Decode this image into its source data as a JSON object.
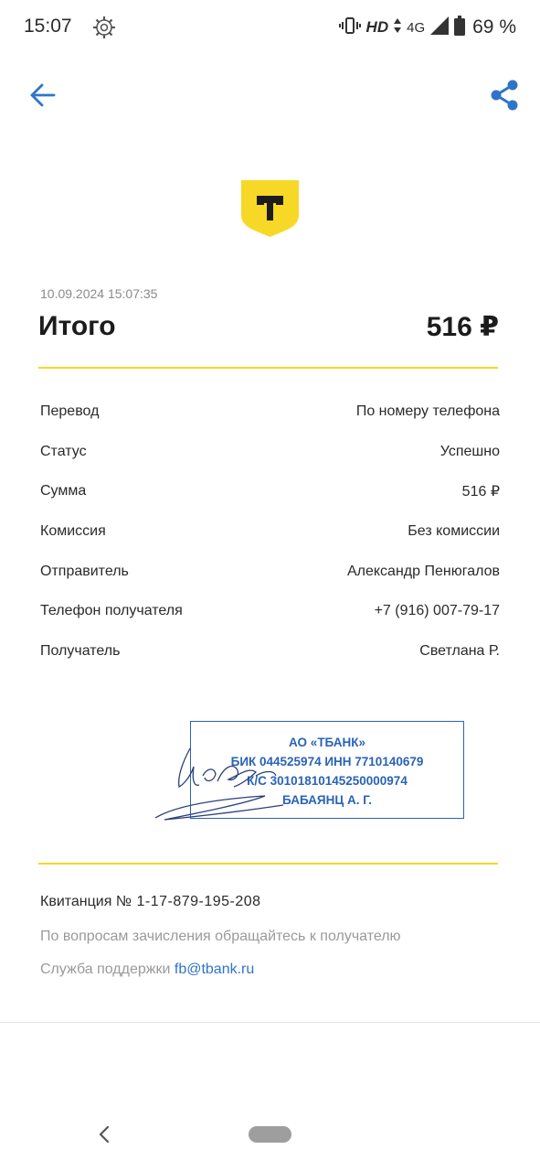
{
  "status_bar": {
    "time": "15:07",
    "hd": "HD",
    "network": "4G",
    "battery": "69 %"
  },
  "toolbar": {
    "back_icon": "arrow-left-icon",
    "share_icon": "share-icon"
  },
  "colors": {
    "accent": "#2f74c8",
    "brand_yellow": "#f7d827",
    "stamp_blue": "#2a63b6"
  },
  "logo": {
    "letter": "Т"
  },
  "receipt": {
    "datetime": "10.09.2024  15:07:35",
    "total_label": "Итого",
    "total_amount": "516 ₽",
    "rows": [
      {
        "label": "Перевод",
        "value": "По номеру телефона"
      },
      {
        "label": "Статус",
        "value": "Успешно"
      },
      {
        "label": "Сумма",
        "value": "516 ₽"
      },
      {
        "label": "Комиссия",
        "value": "Без комиссии"
      },
      {
        "label": "Отправитель",
        "value": "Александр Пенюгалов"
      },
      {
        "label": "Телефон получателя",
        "value": "+7 (916) 007-79-17"
      },
      {
        "label": "Получатель",
        "value": "Светлана Р."
      }
    ]
  },
  "stamp": {
    "lines": [
      "АО «ТБАНК»",
      "БИК 044525974 ИНН 7710140679",
      "К/С 30101810145250000974",
      "БАБАЯНЦ А. Г."
    ]
  },
  "footer": {
    "receipt_label": "Квитанция",
    "receipt_number": "№ 1-17-879-195-208",
    "info": "По вопросам зачисления обращайтесь к получателю",
    "support_label": "Служба поддержки",
    "support_email": "fb@tbank.ru"
  }
}
